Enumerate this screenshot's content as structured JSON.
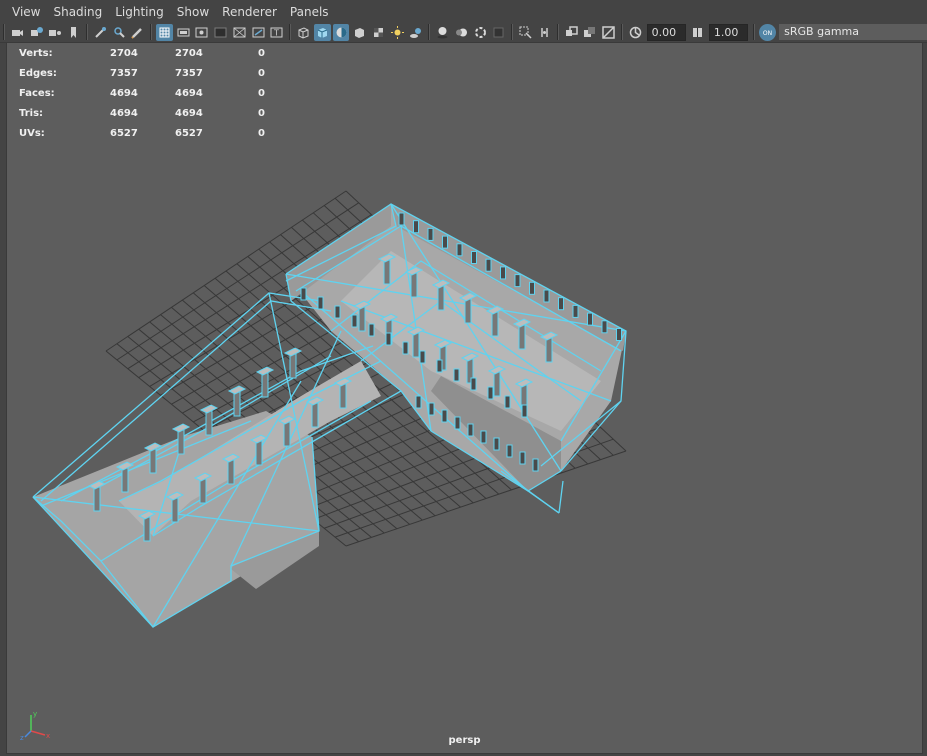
{
  "menu": {
    "items": [
      {
        "label": "View"
      },
      {
        "label": "Shading"
      },
      {
        "label": "Lighting"
      },
      {
        "label": "Show"
      },
      {
        "label": "Renderer"
      },
      {
        "label": "Panels"
      }
    ]
  },
  "toolbar": {
    "exposure_value": "0.00",
    "gamma_value": "1.00",
    "colorspace_label": "sRGB gamma",
    "colorspace_badge": "ON",
    "accent_color": "#5285a6"
  },
  "hud": {
    "rows": [
      {
        "label": "Verts:",
        "v1": "2704",
        "v2": "2704",
        "v3": "0"
      },
      {
        "label": "Edges:",
        "v1": "7357",
        "v2": "7357",
        "v3": "0"
      },
      {
        "label": "Faces:",
        "v1": "4694",
        "v2": "4694",
        "v3": "0"
      },
      {
        "label": "Tris:",
        "v1": "4694",
        "v2": "4694",
        "v3": "0"
      },
      {
        "label": "UVs:",
        "v1": "6527",
        "v2": "6527",
        "v3": "0"
      }
    ]
  },
  "viewport": {
    "camera_label": "persp",
    "wire_color": "#5fd3f0",
    "surface_color": "#a5a5a5",
    "grid_color": "#383838"
  }
}
